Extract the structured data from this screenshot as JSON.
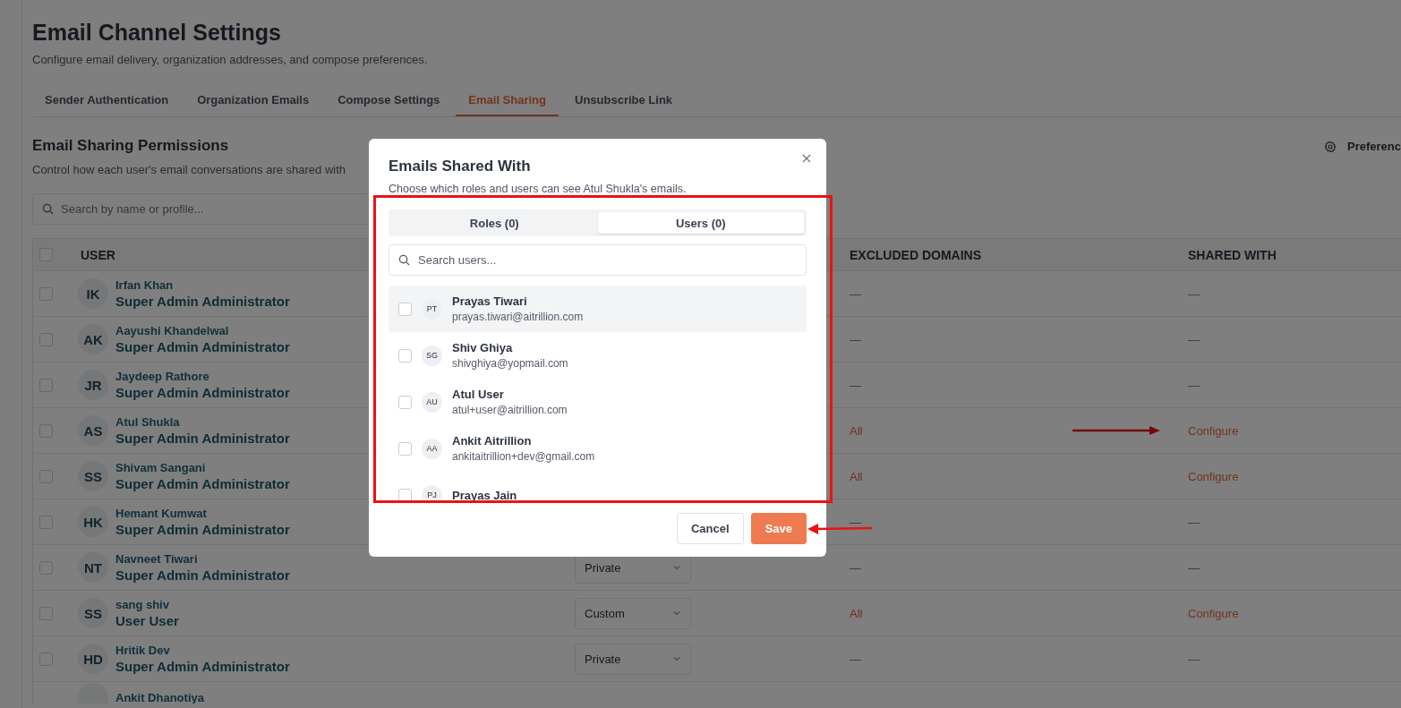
{
  "page": {
    "title": "Email Channel Settings",
    "subtitle": "Configure email delivery, organization addresses, and compose preferences."
  },
  "tabs": [
    {
      "label": "Sender Authentication",
      "selected": false
    },
    {
      "label": "Organization Emails",
      "selected": false
    },
    {
      "label": "Compose Settings",
      "selected": false
    },
    {
      "label": "Email Sharing",
      "selected": true
    },
    {
      "label": "Unsubscribe Link",
      "selected": false
    }
  ],
  "section": {
    "title": "Email Sharing Permissions",
    "subtitle": "Control how each user's email conversations are shared with",
    "search": {
      "placeholder": "Search by name or profile..."
    },
    "preferences": "Preferenc"
  },
  "table": {
    "header_checked": false,
    "columns": [
      {
        "kind": "user",
        "label": "USER"
      },
      {
        "kind": "excluded",
        "label": "EXCLUDED DOMAINS"
      },
      {
        "kind": "shared",
        "label": "SHARED WITH"
      }
    ],
    "rows": [
      {
        "initials": "IK",
        "name": "Irfan Khan",
        "role": "Super Admin Administrator",
        "checked": false,
        "excluded": {
          "kind": "empty",
          "text": "—"
        },
        "shared": {
          "kind": "empty",
          "text": "—"
        }
      },
      {
        "initials": "AK",
        "name": "Aayushi Khandelwal",
        "role": "Super Admin Administrator",
        "checked": false,
        "excluded": {
          "kind": "empty",
          "text": "—"
        },
        "shared": {
          "kind": "empty",
          "text": "—"
        }
      },
      {
        "initials": "JR",
        "name": "Jaydeep Rathore",
        "role": "Super Admin Administrator",
        "checked": false,
        "excluded": {
          "kind": "empty",
          "text": "—"
        },
        "shared": {
          "kind": "empty",
          "text": "—"
        }
      },
      {
        "initials": "AS",
        "name": "Atul Shukla",
        "role": "Super Admin Administrator",
        "checked": false,
        "excluded": {
          "kind": "value",
          "text": "All"
        },
        "shared": {
          "kind": "link",
          "text": "Configure"
        },
        "arrow": true
      },
      {
        "initials": "SS",
        "name": "Shivam Sangani",
        "role": "Super Admin Administrator",
        "checked": false,
        "excluded": {
          "kind": "value",
          "text": "All"
        },
        "shared": {
          "kind": "link",
          "text": "Configure"
        }
      },
      {
        "initials": "HK",
        "name": "Hemant Kumwat",
        "role": "Super Admin Administrator",
        "checked": false,
        "excluded": {
          "kind": "empty",
          "text": "—"
        },
        "shared": {
          "kind": "empty",
          "text": "—"
        }
      },
      {
        "initials": "NT",
        "name": "Navneet Tiwari",
        "role": "Super Admin Administrator",
        "checked": false,
        "sharing": "Private",
        "excluded": {
          "kind": "empty",
          "text": "—"
        },
        "shared": {
          "kind": "empty",
          "text": "—"
        }
      },
      {
        "initials": "SS",
        "name": "sang shiv",
        "role": "User User",
        "checked": false,
        "sharing": "Custom",
        "excluded": {
          "kind": "value",
          "text": "All"
        },
        "shared": {
          "kind": "link",
          "text": "Configure"
        }
      },
      {
        "initials": "HD",
        "name": "Hritik Dev",
        "role": "Super Admin Administrator",
        "checked": false,
        "sharing": "Private",
        "excluded": {
          "kind": "empty",
          "text": "—"
        },
        "shared": {
          "kind": "empty",
          "text": "—"
        }
      },
      {
        "name": "Ankit Dhanotiya"
      }
    ]
  },
  "modal": {
    "title": "Emails Shared With",
    "subtitle": "Choose which roles and users can see Atul Shukla's emails.",
    "highlight_box": true,
    "tabs": [
      {
        "label": "Roles (0)",
        "selected": false
      },
      {
        "label": "Users (0)",
        "selected": true
      }
    ],
    "search": {
      "placeholder": "Search users..."
    },
    "users": [
      {
        "initials": "PT",
        "name": "Prayas Tiwari",
        "email": "prayas.tiwari@aitrillion.com",
        "checked": false,
        "hovered": true
      },
      {
        "initials": "SG",
        "name": "Shiv Ghiya",
        "email": "shivghiya@yopmail.com",
        "checked": false,
        "hovered": false
      },
      {
        "initials": "AU",
        "name": "Atul User",
        "email": "atul+user@aitrillion.com",
        "checked": false,
        "hovered": false
      },
      {
        "initials": "AA",
        "name": "Ankit Aitrillion",
        "email": "ankitaitrillion+dev@gmail.com",
        "checked": false,
        "hovered": false
      },
      {
        "initials": "PJ",
        "name": "Prayas Jain",
        "checked": false,
        "hovered": false
      }
    ],
    "buttons": [
      {
        "kind": "secondary",
        "label": "Cancel"
      },
      {
        "kind": "primary",
        "label": "Save",
        "arrow": true
      }
    ]
  }
}
